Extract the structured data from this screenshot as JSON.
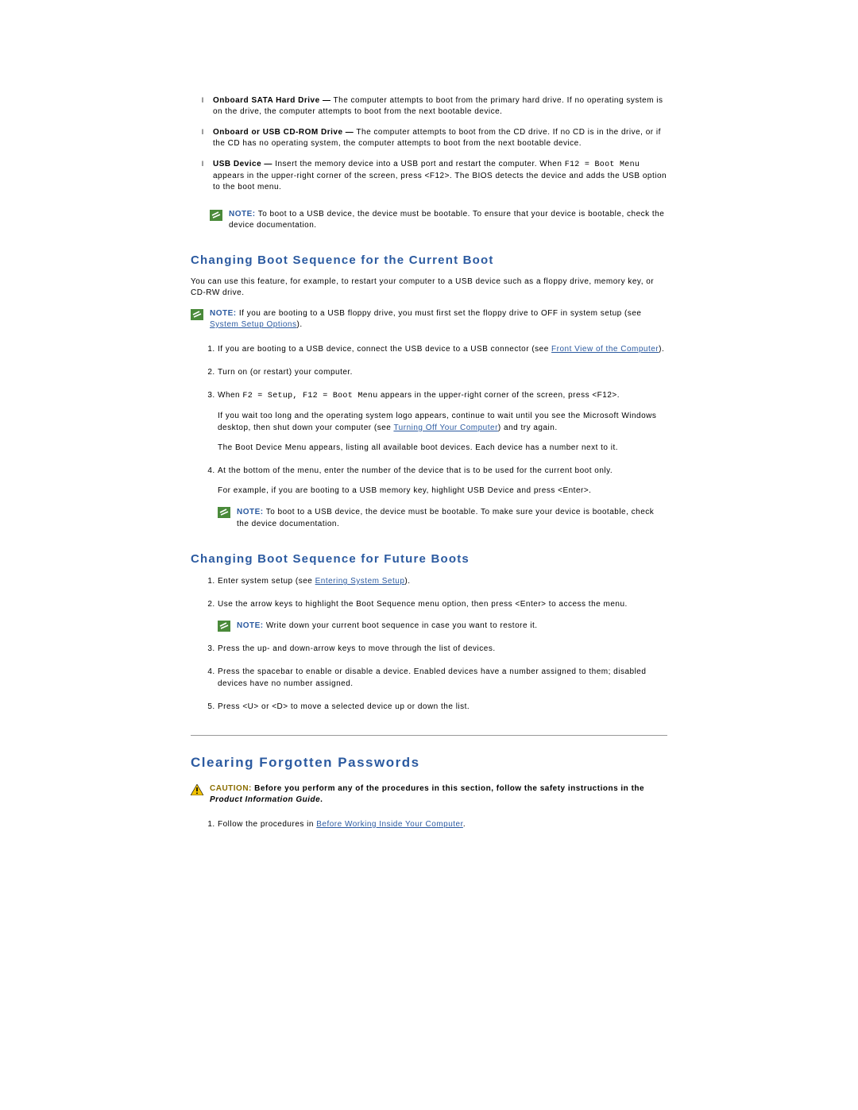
{
  "topList": [
    {
      "bold": "Onboard SATA Hard Drive —",
      "rest": " The computer attempts to boot from the primary hard drive. If no operating system is on the drive, the computer attempts to boot from the next bootable device."
    },
    {
      "bold": "Onboard or USB CD-ROM Drive —",
      "rest": " The computer attempts to boot from the CD drive. If no CD is in the drive, or if the CD has no operating system, the computer attempts to boot from the next bootable device."
    },
    {
      "bold": "USB Device —",
      "rest": " Insert the memory device into a USB port and restart the computer. When ",
      "mono": "F12 = Boot Menu",
      "rest2": " appears in the upper-right corner of the screen, press <F12>. The BIOS detects the device and adds the USB option to the boot menu."
    }
  ],
  "note1": {
    "label": "NOTE:",
    "text": " To boot to a USB device, the device must be bootable. To ensure that your device is bootable, check the device documentation."
  },
  "sectionA": {
    "title": "Changing Boot Sequence for the Current Boot"
  },
  "paraA": "You can use this feature, for example, to restart your computer to a USB device such as a floppy drive, memory key, or CD-RW drive.",
  "note2": {
    "label": "NOTE:",
    "text1": " If you are booting to a USB floppy drive, you must first set the floppy drive to OFF in system setup (see ",
    "link": "System Setup Options",
    "text2": ")."
  },
  "stepsA": [
    {
      "pre": "If you are booting to a USB device, connect the USB device to a USB connector (see ",
      "link": "Front View of the Computer",
      "post": ")."
    },
    {
      "text": "Turn on (or restart) your computer."
    },
    {
      "pre": "When ",
      "mono": "F2 = Setup, F12 = Boot Menu",
      "post": " appears in the upper-right corner of the screen, press <F12>.",
      "p1pre": "If you wait too long and the operating system logo appears, continue to wait until you see the Microsoft Windows desktop, then shut down your computer (see ",
      "p1link": "Turning Off Your Computer",
      "p1post": ") and try again.",
      "p2": "The Boot Device Menu appears, listing all available boot devices. Each device has a number next to it."
    },
    {
      "text": "At the bottom of the menu, enter the number of the device that is to be used for the current boot only.",
      "p1": "For example, if you are booting to a USB memory key, highlight USB Device and press <Enter>.",
      "note": {
        "label": "NOTE:",
        "text": " To boot to a USB device, the device must be bootable. To make sure your device is bootable, check the device documentation."
      }
    }
  ],
  "sectionB": {
    "title": "Changing Boot Sequence for Future Boots"
  },
  "stepsB": [
    {
      "pre": "Enter system setup (see ",
      "link": "Entering System Setup",
      "post": ")."
    },
    {
      "text": "Use the arrow keys to highlight the Boot Sequence menu option, then press <Enter> to access the menu.",
      "note": {
        "label": "NOTE:",
        "text": " Write down your current boot sequence in case you want to restore it."
      }
    },
    {
      "text": "Press the up- and down-arrow keys to move through the list of devices."
    },
    {
      "text": "Press the spacebar to enable or disable a device. Enabled devices have a number assigned to them; disabled devices have no number assigned."
    },
    {
      "text": "Press <U> or <D> to move a selected device up or down the list."
    }
  ],
  "sectionC": {
    "title": "Clearing Forgotten Passwords"
  },
  "caution": {
    "label": "CAUTION:",
    "text": " Before you perform any of the procedures in this section, follow the safety instructions in the ",
    "ital": "Product Information Guide",
    "dot": "."
  },
  "stepsC": [
    {
      "pre": "Follow the procedures in ",
      "link": "Before Working Inside Your Computer",
      "post": "."
    }
  ]
}
